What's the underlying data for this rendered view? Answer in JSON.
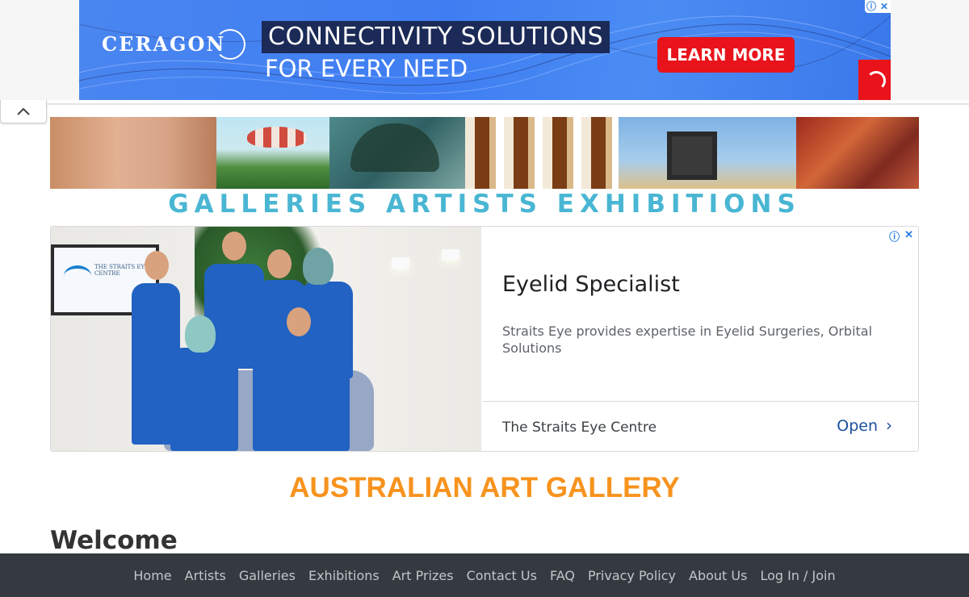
{
  "top_ad": {
    "brand": "CERAGON",
    "headline": "CONNECTIVITY SOLUTIONS",
    "subline": "FOR EVERY NEED",
    "cta": "LEARN MORE",
    "adchoice_info": "ⓘ",
    "adchoice_close": "✕"
  },
  "collapse_icon": "^",
  "header": {
    "title": "GALLERIES ARTISTS EXHIBITIONS"
  },
  "ad2": {
    "title": "Eyelid Specialist",
    "description": "Straits Eye provides expertise in Eyelid Surgeries, Orbital Solutions",
    "advertiser": "The Straits Eye Centre",
    "cta": "Open",
    "tv_text": "THE STRAITS EYE CENTRE"
  },
  "page": {
    "heading": "AUSTRALIAN ART GALLERY",
    "welcome": "Welcome"
  },
  "footer": {
    "links": [
      "Home",
      "Artists",
      "Galleries",
      "Exhibitions",
      "Art Prizes",
      "Contact Us",
      "FAQ",
      "Privacy Policy",
      "About Us",
      "Log In / Join"
    ]
  },
  "colors": {
    "heading_orange": "#f7931e",
    "header_title_blue": "#49b6d3",
    "footer_bg": "#343a40",
    "ad_red": "#e8131b"
  }
}
